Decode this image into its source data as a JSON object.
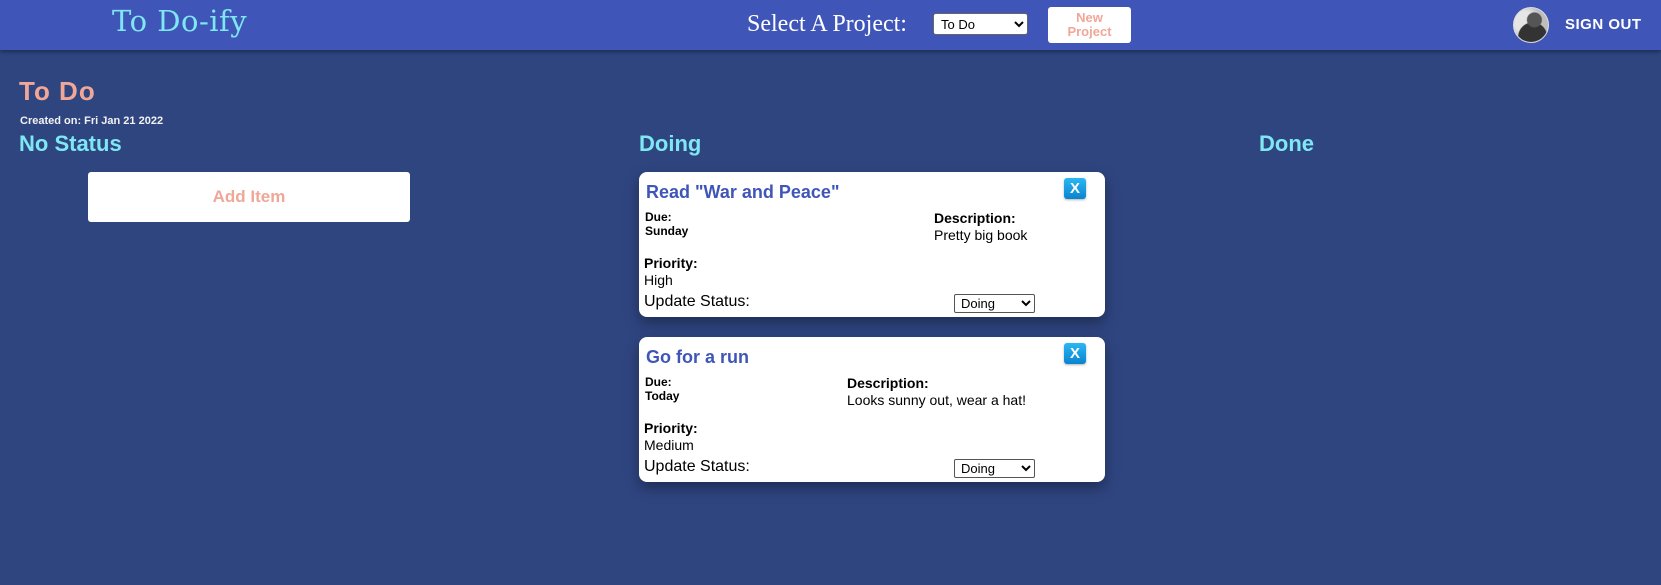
{
  "header": {
    "brand": "To Do-ify",
    "select_label": "Select A Project:",
    "project_select_value": "To Do",
    "new_project_label": "New Project",
    "signout_label": "SIGN OUT"
  },
  "project": {
    "title": "To Do",
    "created": "Created on: Fri Jan 21 2022"
  },
  "columns": {
    "no_status": "No Status",
    "doing": "Doing",
    "done": "Done"
  },
  "add_item_label": "Add Item",
  "cards": [
    {
      "title": "Read \"War and Peace\"",
      "close_label": "X",
      "due_label": "Due:",
      "due": "Sunday",
      "description_label": "Description:",
      "description": "Pretty big book",
      "priority_label": "Priority:",
      "priority": "High",
      "status_label": "Update Status:",
      "status_value": "Doing"
    },
    {
      "title": "Go for a run",
      "close_label": "X",
      "due_label": "Due:",
      "due": "Today",
      "description_label": "Description:",
      "description": "Looks sunny out, wear a hat!",
      "priority_label": "Priority:",
      "priority": "Medium",
      "status_label": "Update Status:",
      "status_value": "Doing"
    }
  ],
  "colors": {
    "header_bg": "#3f56b8",
    "page_bg": "#2f4580",
    "accent_cyan": "#7fe7f2",
    "accent_salmon": "#f0a798"
  }
}
